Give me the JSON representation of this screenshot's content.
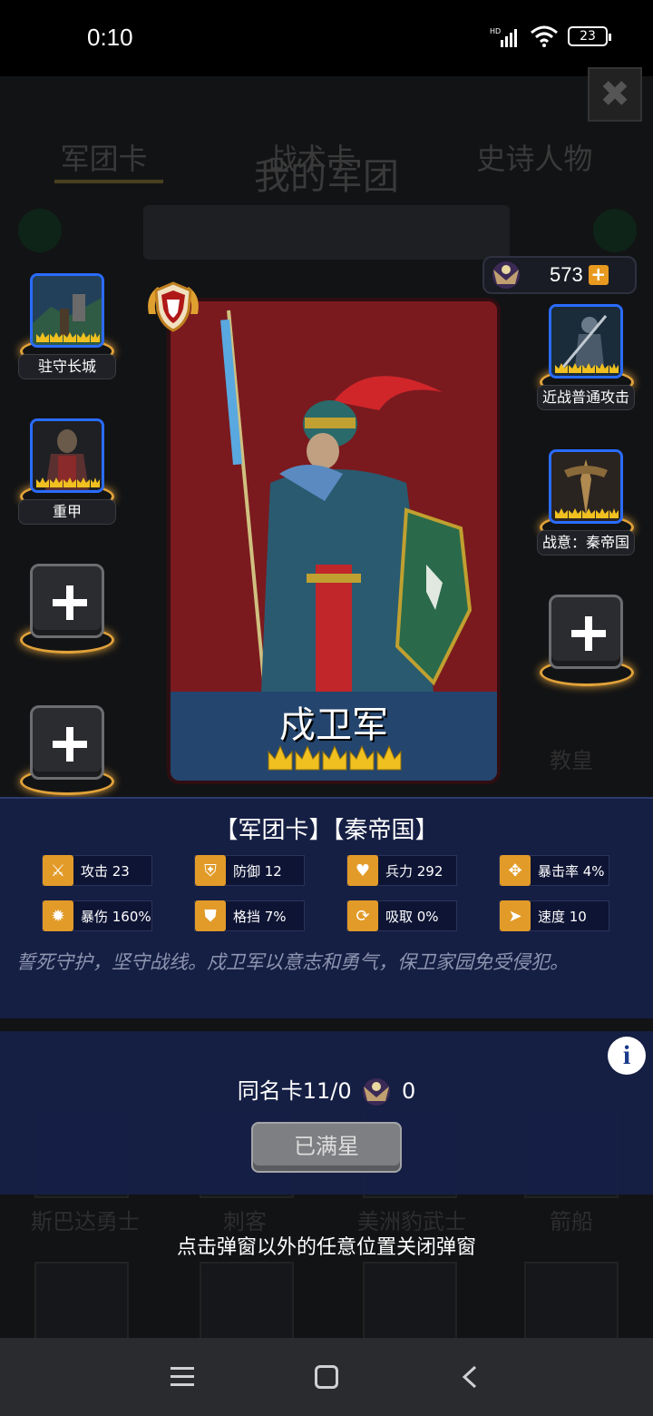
{
  "status_bar": {
    "time": "0:10",
    "battery": "23",
    "network": "HD"
  },
  "background_screen": {
    "title": "我的军团",
    "tabs": [
      "军团卡",
      "战术卡",
      "史诗人物"
    ],
    "grid_labels": [
      "斯巴达勇士",
      "刺客",
      "美洲豹武士",
      "箭船",
      "教皇"
    ]
  },
  "currency": {
    "value": "573"
  },
  "left_slots": [
    {
      "label": "驻守长城"
    },
    {
      "label": "重甲"
    }
  ],
  "right_slots": [
    {
      "label": "近战普通攻击"
    },
    {
      "label": "战意：秦帝国"
    }
  ],
  "hero": {
    "name": "戍卫军",
    "star_count": 5
  },
  "info": {
    "category_line": "【军团卡】【秦帝国】",
    "stats": [
      {
        "label": "攻击 23",
        "icon": "sword-icon"
      },
      {
        "label": "防御 12",
        "icon": "shield-icon"
      },
      {
        "label": "兵力 292",
        "icon": "heart-icon"
      },
      {
        "label": "暴击率 4%",
        "icon": "crosshair-icon"
      },
      {
        "label": "暴伤 160%",
        "icon": "burst-icon"
      },
      {
        "label": "格挡 7%",
        "icon": "block-icon"
      },
      {
        "label": "吸取 0%",
        "icon": "drain-icon"
      },
      {
        "label": "速度 10",
        "icon": "boot-icon"
      }
    ],
    "description": "誓死守护，坚守战线。戍卫军以意志和勇气，保卫家园免受侵犯。"
  },
  "star_panel": {
    "duplicate_text": "同名卡11/0",
    "emblem_count": "0",
    "maxed_button": "已满星"
  },
  "hint": "点击弹窗以外的任意位置关闭弹窗",
  "colors": {
    "accent_gold": "#e29b28",
    "slot_blue": "#2a6cff",
    "panel_navy": "#16204a",
    "card_red": "#7a1a1e"
  }
}
